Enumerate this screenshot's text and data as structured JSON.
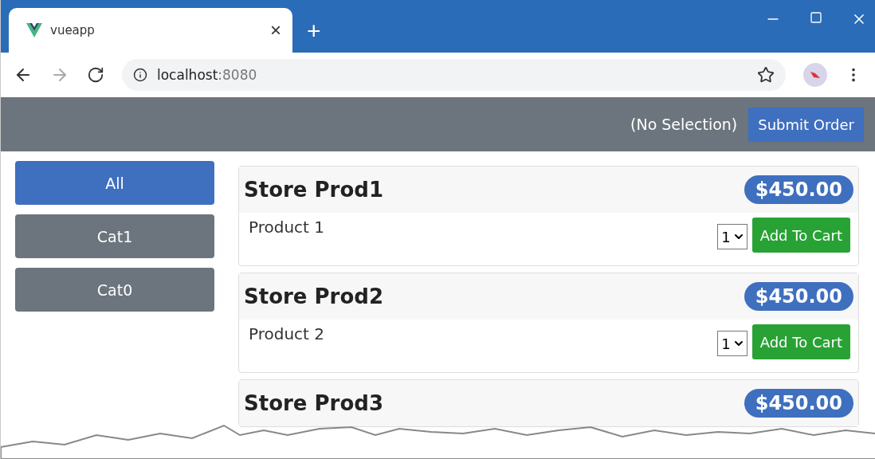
{
  "browser": {
    "tab": {
      "title": "vueapp",
      "close": "×"
    },
    "new_tab": "+",
    "url": {
      "host": "localhost",
      "port": ":8080"
    }
  },
  "navbar": {
    "selection": "(No Selection)",
    "submit": "Submit Order"
  },
  "categories": [
    {
      "label": "All",
      "selected": true
    },
    {
      "label": "Cat1",
      "selected": false
    },
    {
      "label": "Cat0",
      "selected": false
    }
  ],
  "products": [
    {
      "name": "Store Prod1",
      "price": "$450.00",
      "description": "Product 1",
      "quantity": "1",
      "button": "Add To Cart"
    },
    {
      "name": "Store Prod2",
      "price": "$450.00",
      "description": "Product 2",
      "quantity": "1",
      "button": "Add To Cart"
    },
    {
      "name": "Store Prod3",
      "price": "$450.00"
    }
  ]
}
